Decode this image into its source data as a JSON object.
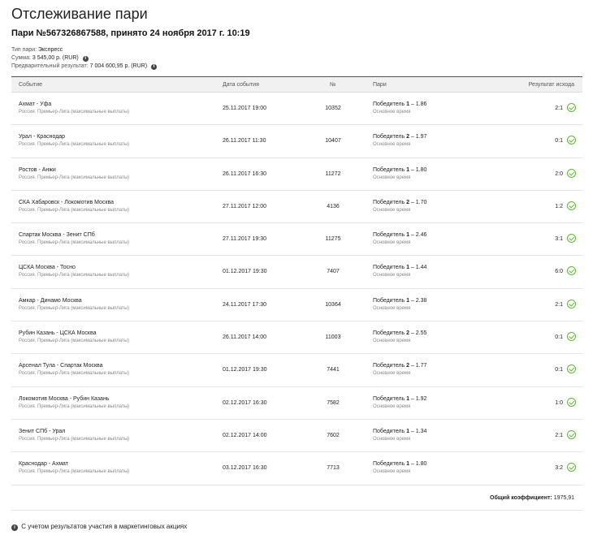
{
  "header": {
    "title": "Отслеживание пари",
    "subtitle": "Пари №567326867588, принято 24 ноября 2017 г. 10:19"
  },
  "meta": {
    "type_label": "Тип пари:",
    "type_value": "Экспресс",
    "amount_label": "Сумма:",
    "amount_value": "3 545,00 р. (RUR)",
    "prelim_label": "Предварительный результат:",
    "prelim_value": "7 004 600,95 р. (RUR)"
  },
  "table": {
    "headers": {
      "event": "Событие",
      "date": "Дата события",
      "num": "№",
      "bet": "Пари",
      "result": "Результат исхода"
    },
    "rows": [
      {
        "event": "Ахмат - Уфа",
        "league": "Россия. Премьер-Лига (максимальные выплаты)",
        "date": "25.11.2017 19:00",
        "num": "10352",
        "bet_prefix": "Победитель ",
        "bet_num": "1",
        "bet_odds": " – 1.86",
        "bet_sub": "Основное время",
        "result": "2:1"
      },
      {
        "event": "Урал - Краснодар",
        "league": "Россия. Премьер-Лига (максимальные выплаты)",
        "date": "26.11.2017 11:30",
        "num": "10407",
        "bet_prefix": "Победитель ",
        "bet_num": "2",
        "bet_odds": " – 1.97",
        "bet_sub": "Основное время",
        "result": "0:1"
      },
      {
        "event": "Ростов - Анжи",
        "league": "Россия. Премьер-Лига (максимальные выплаты)",
        "date": "26.11.2017 16:30",
        "num": "11272",
        "bet_prefix": "Победитель ",
        "bet_num": "1",
        "bet_odds": " – 1.80",
        "bet_sub": "Основное время",
        "result": "2:0"
      },
      {
        "event": "СКА Хабаровск - Локомотив Москва",
        "league": "Россия. Премьер-Лига (максимальные выплаты)",
        "date": "27.11.2017 12:00",
        "num": "4136",
        "bet_prefix": "Победитель ",
        "bet_num": "2",
        "bet_odds": " – 1.70",
        "bet_sub": "Основное время",
        "result": "1:2"
      },
      {
        "event": "Спартак Москва - Зенит СПб",
        "league": "Россия. Премьер-Лига (максимальные выплаты)",
        "date": "27.11.2017 19:30",
        "num": "11275",
        "bet_prefix": "Победитель ",
        "bet_num": "1",
        "bet_odds": " – 2.46",
        "bet_sub": "Основное время",
        "result": "3:1"
      },
      {
        "event": "ЦСКА Москва - Тосно",
        "league": "Россия. Премьер-Лига (максимальные выплаты)",
        "date": "01.12.2017 19:30",
        "num": "7407",
        "bet_prefix": "Победитель ",
        "bet_num": "1",
        "bet_odds": " – 1.44",
        "bet_sub": "Основное время",
        "result": "6:0"
      },
      {
        "event": "Амкар - Динамо Москва",
        "league": "Россия. Премьер-Лига (максимальные выплаты)",
        "date": "24.11.2017 17:30",
        "num": "10364",
        "bet_prefix": "Победитель ",
        "bet_num": "1",
        "bet_odds": " – 2.38",
        "bet_sub": "Основное время",
        "result": "2:1"
      },
      {
        "event": "Рубин Казань - ЦСКА Москва",
        "league": "Россия. Премьер-Лига (максимальные выплаты)",
        "date": "26.11.2017 14:00",
        "num": "11003",
        "bet_prefix": "Победитель ",
        "bet_num": "2",
        "bet_odds": " – 2.55",
        "bet_sub": "Основное время",
        "result": "0:1"
      },
      {
        "event": "Арсенал Тула - Спартак Москва",
        "league": "Россия. Премьер-Лига (максимальные выплаты)",
        "date": "01.12.2017 19:30",
        "num": "7441",
        "bet_prefix": "Победитель ",
        "bet_num": "2",
        "bet_odds": " – 1.77",
        "bet_sub": "Основное время",
        "result": "0:1"
      },
      {
        "event": "Локомотив Москва - Рубин Казань",
        "league": "Россия. Премьер-Лига (максимальные выплаты)",
        "date": "02.12.2017 16:30",
        "num": "7582",
        "bet_prefix": "Победитель ",
        "bet_num": "1",
        "bet_odds": " – 1.92",
        "bet_sub": "Основное время",
        "result": "1:0"
      },
      {
        "event": "Зенит СПб - Урал",
        "league": "Россия. Премьер-Лига (максимальные выплаты)",
        "date": "02.12.2017 14:00",
        "num": "7602",
        "bet_prefix": "Победитель ",
        "bet_num": "1",
        "bet_odds": " – 1.34",
        "bet_sub": "Основное время",
        "result": "2:1"
      },
      {
        "event": "Краснодар - Ахмат",
        "league": "Россия. Премьер-Лига (максимальные выплаты)",
        "date": "03.12.2017 16:30",
        "num": "7713",
        "bet_prefix": "Победитель ",
        "bet_num": "1",
        "bet_odds": " – 1.80",
        "bet_sub": "Основное время",
        "result": "3:2"
      }
    ],
    "total_label": "Общий коэффициент:",
    "total_value": "1975,91"
  },
  "footnote": "С учетом результатов участия в маркетинговых акциях",
  "colors": {
    "success": "#62b53a",
    "header_bg": "#f1f1f1"
  }
}
